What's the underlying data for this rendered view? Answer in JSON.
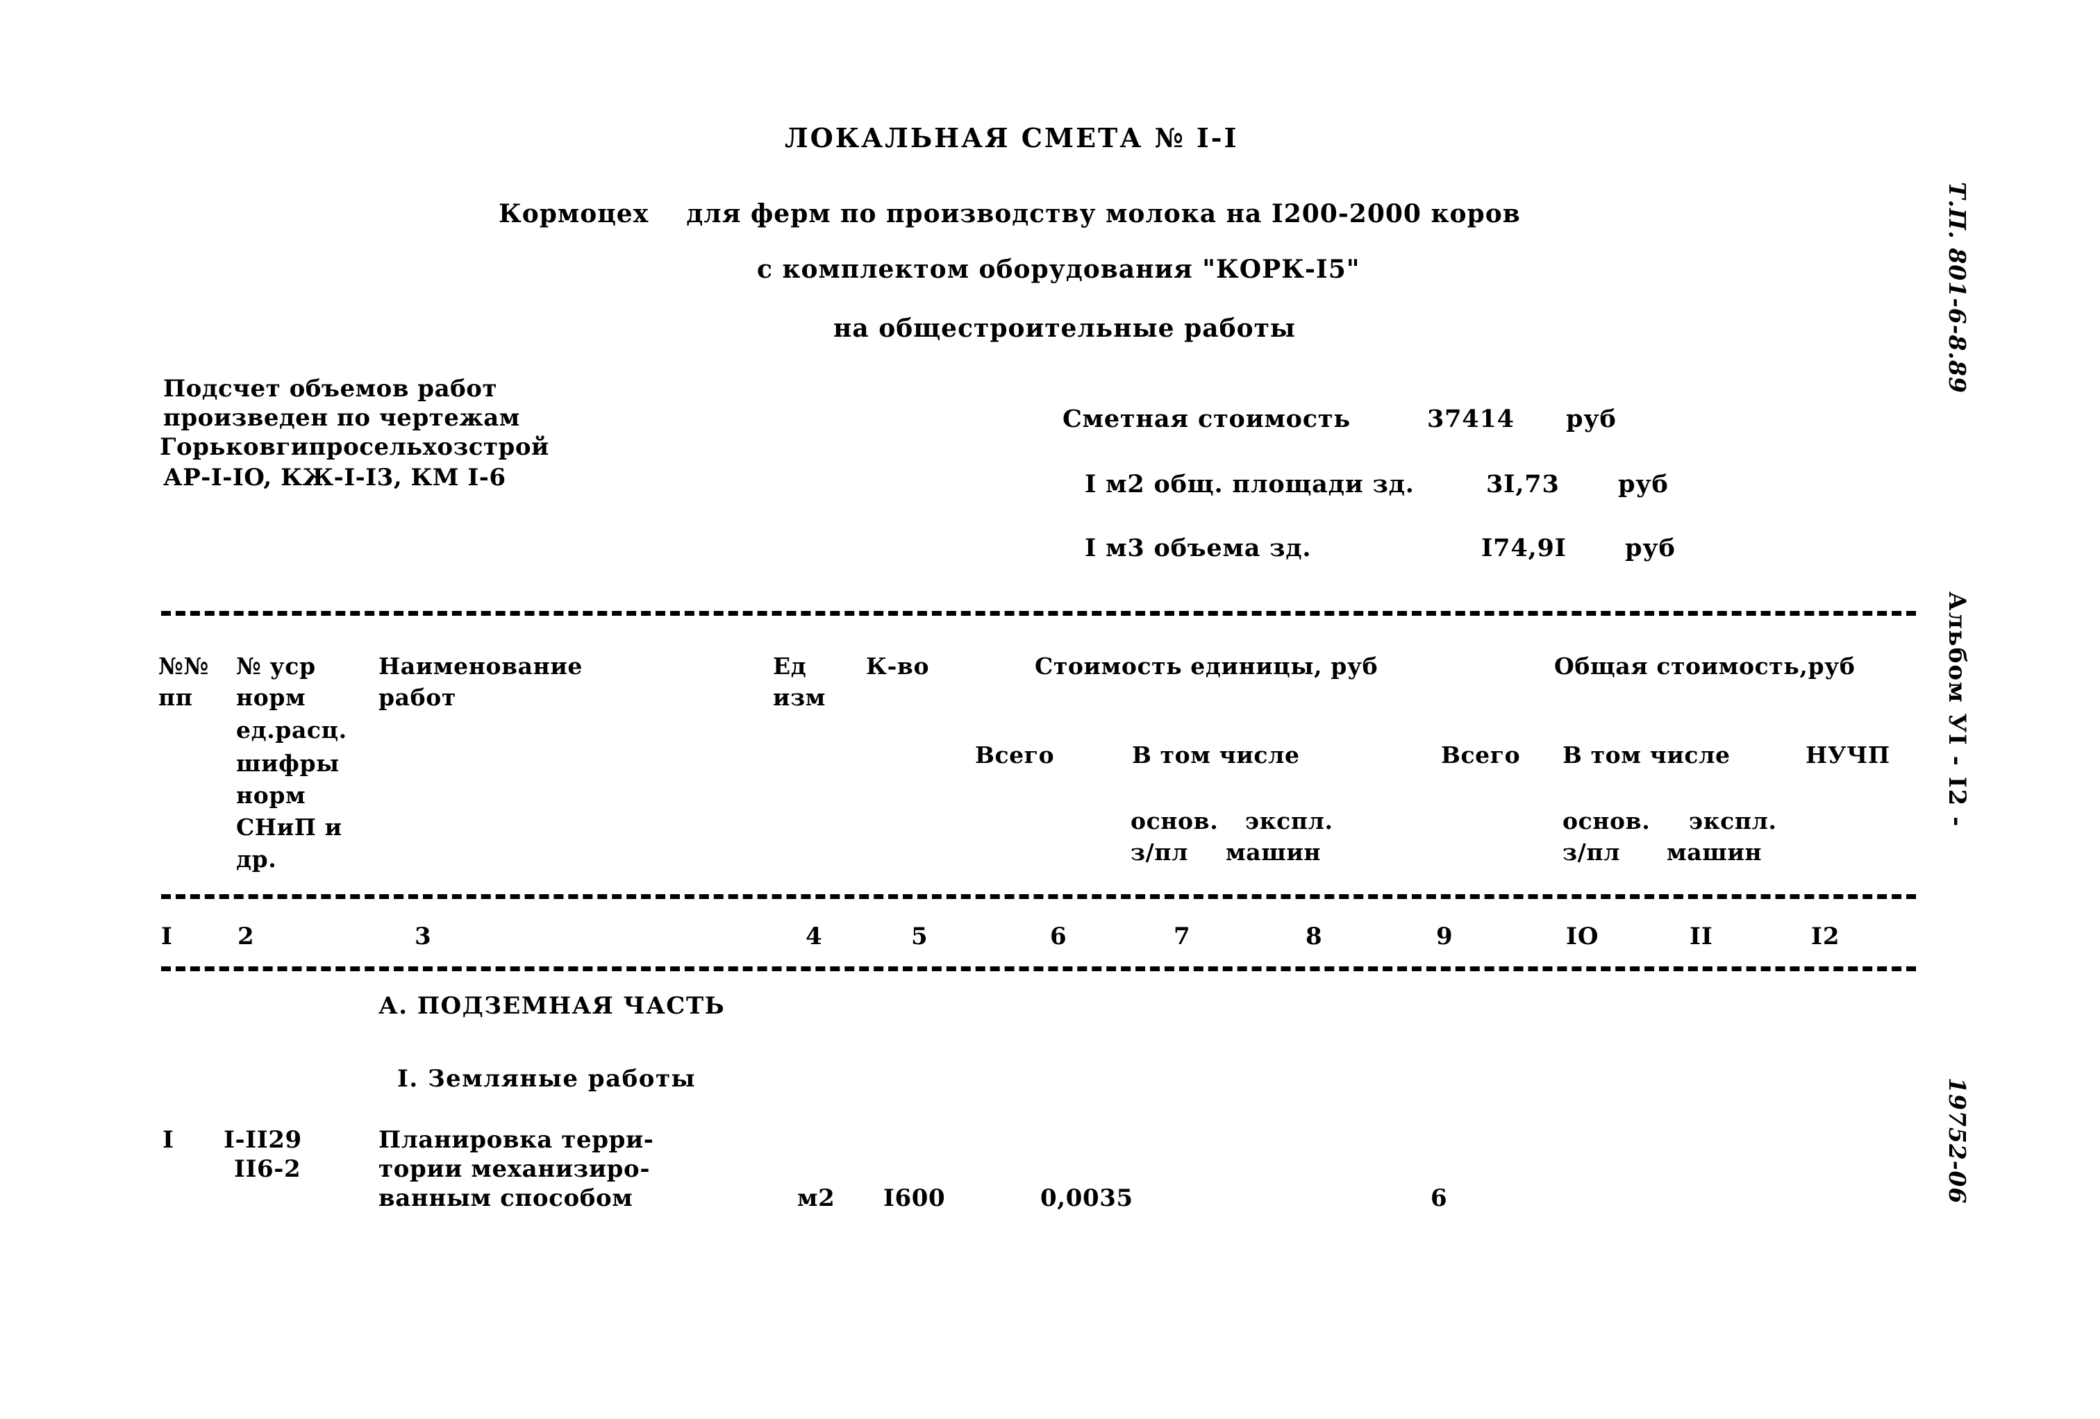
{
  "document": {
    "title": "ЛОКАЛЬНАЯ СМЕТА № I-I",
    "subtitle_line1": "Кормоцех    для ферм по производству молока на I200-2000 коров",
    "subtitle_line2": "с комплектом оборудования \"КОРК-I5\"",
    "subtitle_line3": "на общестроительные работы"
  },
  "source_note": {
    "line1": "Подсчет объемов работ",
    "line2": "произведен по чертежам",
    "line3": "Горьковгипросельхозстрой",
    "line4": "АР-I-IO, КЖ-I-I3, КМ I-6"
  },
  "cost_summary": [
    {
      "label": "Сметная стоимость",
      "value": "37414",
      "unit": "руб"
    },
    {
      "label": "I м2 общ. площади зд.",
      "value": "3I,73",
      "unit": "руб"
    },
    {
      "label": "I м3 объема зд.",
      "value": "I74,9I",
      "unit": "руб"
    }
  ],
  "table": {
    "headers": {
      "col1_line1": "№№",
      "col1_line2": "пп",
      "col2_line1": "№ уср",
      "col2_line2": "норм",
      "col2_line3": "ед.расц.",
      "col2_line4": "шифры",
      "col2_line5": "норм",
      "col2_line6": "СНиП и",
      "col2_line7": "др.",
      "col3_line1": "Наименование",
      "col3_line2": "работ",
      "col4_line1": "Ед",
      "col4_line2": "изм",
      "col5": "К-во",
      "group_unit_cost": "Стоимость единицы, руб",
      "group_total_cost": "Общая стоимость,руб",
      "unit_total": "Всего",
      "unit_among": "В том числе",
      "unit_basic": "основ.",
      "unit_basic_sub": "з/пл",
      "unit_mach": "экспл.",
      "unit_mach_sub": "машин",
      "total_total": "Всего",
      "total_among": "В том числе",
      "total_basic": "основ.",
      "total_basic_sub": "з/пл",
      "total_mach": "экспл.",
      "total_mach_sub": "машин",
      "nuchp": "НУЧП"
    },
    "column_numbers": [
      "I",
      "2",
      "3",
      "4",
      "5",
      "6",
      "7",
      "8",
      "9",
      "IO",
      "II",
      "I2"
    ],
    "sections": [
      {
        "label": "А. ПОДЗЕМНАЯ ЧАСТЬ"
      },
      {
        "label": "I. Земляные работы"
      }
    ],
    "rows": [
      {
        "num": "I",
        "norm_line1": "I-II29",
        "norm_line2": "II6-2",
        "name_line1": "Планировка терри-",
        "name_line2": "тории механизиро-",
        "name_line3": "ванным способом",
        "unit": "м2",
        "qty": "I600",
        "unit_cost_total": "0,0035",
        "unit_cost_basic": "",
        "unit_cost_mach": "",
        "total_cost_total": "6",
        "total_cost_basic": "",
        "total_cost_mach": "",
        "nuchp": ""
      }
    ]
  },
  "margin_stamps": {
    "project_code": "Т.П. 801-6-8.89",
    "album": "Альбом УI - I2 -",
    "archive_number": "19752-06"
  }
}
